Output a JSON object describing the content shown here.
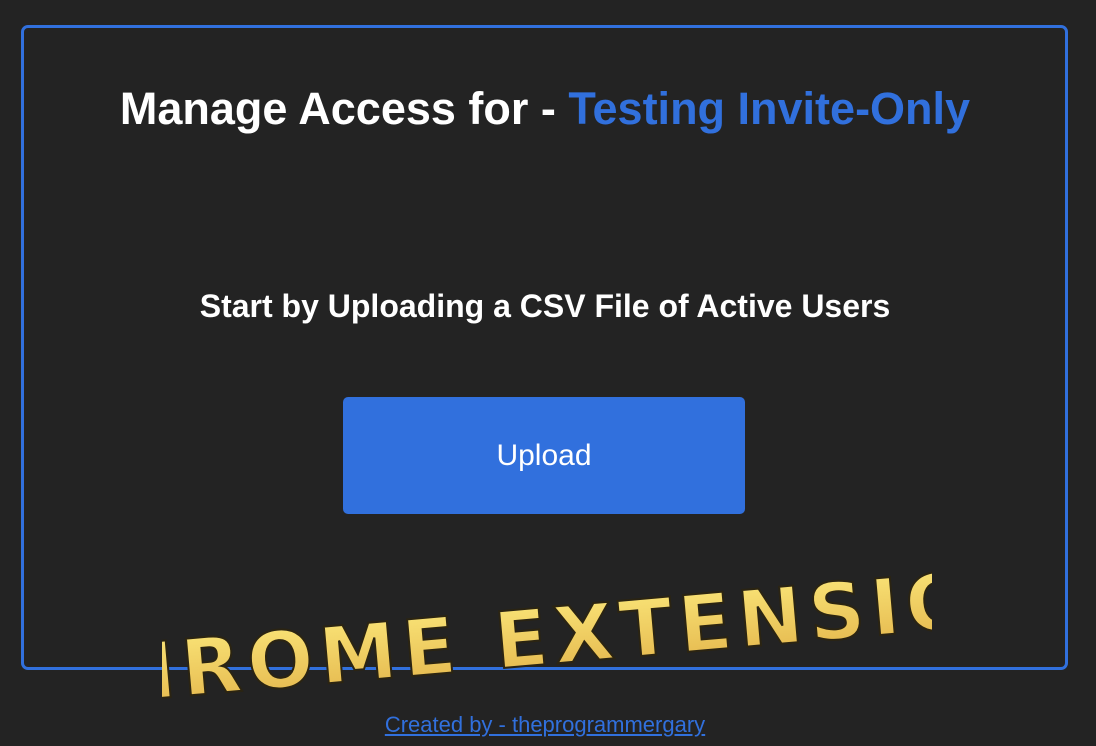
{
  "header": {
    "title_prefix": "Manage Access for - ",
    "title_accent": "Testing Invite-Only"
  },
  "main": {
    "instruction": "Start by Uploading a CSV File of Active Users",
    "upload_label": "Upload"
  },
  "overlay": {
    "watermark_text": "CHROME EXTENSION"
  },
  "footer": {
    "credit_link": "Created by - theprogrammergary"
  },
  "colors": {
    "background": "#232323",
    "accent": "#3170dd",
    "text": "#ffffff",
    "watermark_fill": "#f2d35f"
  }
}
